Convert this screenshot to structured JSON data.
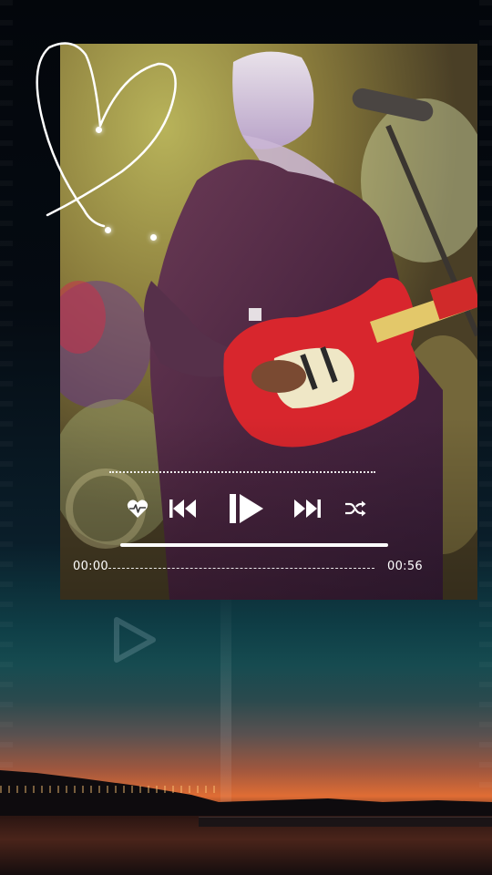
{
  "player": {
    "current_time": "00:00",
    "total_time": "00:56",
    "progress": 0.0
  },
  "controls": {
    "like_icon": "heart-pulse-icon",
    "prev_icon": "skip-previous-icon",
    "play_icon": "play-icon",
    "next_icon": "skip-next-icon",
    "shuffle_icon": "shuffle-icon"
  },
  "colors": {
    "accent": "#ffffff",
    "guitar": "#d8262d",
    "sky_teal": "#0f3f47",
    "sunset_orange": "#e06d34"
  }
}
